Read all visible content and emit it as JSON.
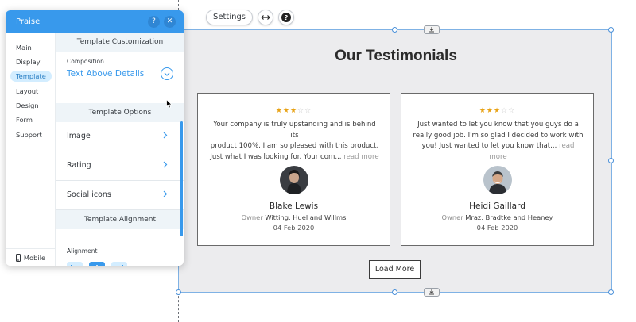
{
  "editor": {
    "settings_label": "Settings"
  },
  "panel": {
    "title": "Praise",
    "help_icon": "?",
    "close_icon": "✕",
    "nav": [
      {
        "label": "Main"
      },
      {
        "label": "Display"
      },
      {
        "label": "Template"
      },
      {
        "label": "Layout"
      },
      {
        "label": "Design"
      },
      {
        "label": "Form"
      },
      {
        "label": "Support"
      }
    ],
    "active_nav": "Template",
    "mobile_label": "Mobile",
    "template_customization_heading": "Template Customization",
    "composition_label": "Composition",
    "composition_value": "Text Above Details",
    "template_options_heading": "Template Options",
    "options": [
      {
        "label": "Image"
      },
      {
        "label": "Rating"
      },
      {
        "label": "Social icons"
      }
    ],
    "template_alignment_heading": "Template Alignment",
    "alignment_label": "Alignment",
    "accent_color": "#3899ec"
  },
  "section": {
    "title": "Our Testimonials",
    "testimonials": [
      {
        "rating": 3,
        "max_rating": 5,
        "quote_line1": "Your company is truly upstanding and is behind its",
        "quote_line2": "product 100%. I am so pleased with this product.",
        "quote_line3": "Just what I was looking for. Your com...",
        "read_more": "read more",
        "name": "Blake Lewis",
        "role": "Owner",
        "company": "Witting, Huel and Willms",
        "date": "04 Feb 2020"
      },
      {
        "rating": 3,
        "max_rating": 5,
        "quote_line1": "Just wanted to let you know that you guys do a",
        "quote_line2": "really good job. I'm so glad I decided to work with",
        "quote_line3": "you! Just wanted to let you know that...",
        "read_more": "read more",
        "name": "Heidi Gaillard",
        "role": "Owner",
        "company": "Mraz, Bradtke and Heaney",
        "date": "04 Feb 2020"
      }
    ],
    "load_more_label": "Load More",
    "star_color": "#e8a317"
  }
}
